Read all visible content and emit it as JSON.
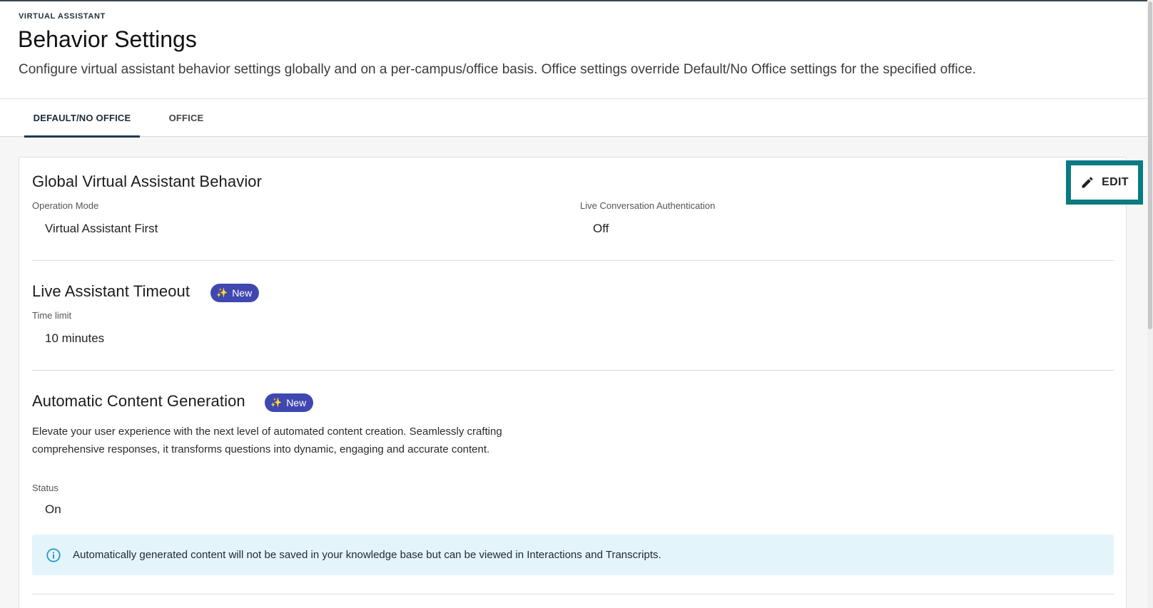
{
  "header": {
    "overline": "VIRTUAL ASSISTANT",
    "title": "Behavior Settings",
    "description": "Configure virtual assistant behavior settings globally and on a per-campus/office basis. Office settings override Default/No Office settings for the specified office."
  },
  "tabs": [
    {
      "label": "DEFAULT/NO OFFICE",
      "active": true
    },
    {
      "label": "OFFICE",
      "active": false
    }
  ],
  "card": {
    "edit_label": "EDIT",
    "global": {
      "title": "Global Virtual Assistant Behavior",
      "operation_mode_label": "Operation Mode",
      "operation_mode_value": "Virtual Assistant First",
      "live_auth_label": "Live Conversation Authentication",
      "live_auth_value": "Off"
    },
    "timeout": {
      "title": "Live Assistant Timeout",
      "badge": "New",
      "time_limit_label": "Time limit",
      "time_limit_value": "10 minutes"
    },
    "content_generation": {
      "title": "Automatic Content Generation",
      "badge": "New",
      "description": "Elevate your user experience with the next level of automated content creation. Seamlessly crafting comprehensive responses, it transforms questions into dynamic, engaging and accurate content.",
      "status_label": "Status",
      "status_value": "On",
      "info": "Automatically generated content will not be saved in your knowledge base but can be viewed in Interactions and Transcripts."
    }
  },
  "colors": {
    "accent_outline": "#0b7a82",
    "badge_bg": "#3f48b0",
    "info_bg": "#e4f4fb",
    "tab_indicator": "#1d3a4f"
  }
}
